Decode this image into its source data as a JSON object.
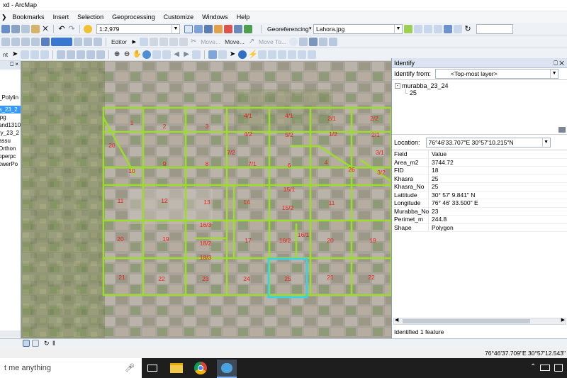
{
  "window": {
    "title": "xd - ArcMap"
  },
  "menu": [
    "Bookmarks",
    "Insert",
    "Selection",
    "Geoprocessing",
    "Customize",
    "Windows",
    "Help"
  ],
  "toolbar": {
    "scale_value": "1:2,979",
    "georef_label": "Georeferencing",
    "georef_layer": "Lahora.jpg",
    "editor_label": "Editor",
    "move_label": "Move...",
    "move2_label": "Move...",
    "move_to_label": "Move To...",
    "left_stub": "nt"
  },
  "toc": {
    "pin": "⎕ ×",
    "items": [
      {
        "label": "_Polylin",
        "selected": false
      },
      {
        "label": "a_23_2",
        "selected": true
      },
      {
        "label": "jpg",
        "selected": false
      },
      {
        "label": "and1310",
        "selected": false
      },
      {
        "label": "ry_23_2",
        "selected": false
      },
      {
        "label": "assu",
        "selected": false
      },
      {
        "label": "Orthon",
        "selected": false
      },
      {
        "label": "pperpc",
        "selected": false
      },
      {
        "label": "owerPo",
        "selected": false
      }
    ]
  },
  "map": {
    "parcels": [
      {
        "label": "1"
      },
      {
        "label": "2"
      },
      {
        "label": "3"
      },
      {
        "label": "4/1"
      },
      {
        "label": "4/1"
      },
      {
        "label": "2/1"
      },
      {
        "label": "2/2"
      },
      {
        "label": "20"
      },
      {
        "label": "4/2"
      },
      {
        "label": "5/2"
      },
      {
        "label": "1/2"
      },
      {
        "label": "2/1"
      },
      {
        "label": "10"
      },
      {
        "label": "9"
      },
      {
        "label": "8"
      },
      {
        "label": "7/2"
      },
      {
        "label": "7/1"
      },
      {
        "label": "6"
      },
      {
        "label": "4"
      },
      {
        "label": "26"
      },
      {
        "label": "3/1"
      },
      {
        "label": "3/2"
      },
      {
        "label": "15/1"
      },
      {
        "label": "11"
      },
      {
        "label": "12"
      },
      {
        "label": "13"
      },
      {
        "label": "14"
      },
      {
        "label": "15/2"
      },
      {
        "label": "11"
      },
      {
        "label": "16/1"
      },
      {
        "label": "16/3"
      },
      {
        "label": "20"
      },
      {
        "label": "19"
      },
      {
        "label": "18/2"
      },
      {
        "label": "17"
      },
      {
        "label": "16/2"
      },
      {
        "label": "20"
      },
      {
        "label": "19"
      },
      {
        "label": "18/3"
      },
      {
        "label": "21"
      },
      {
        "label": "22"
      },
      {
        "label": "23"
      },
      {
        "label": "24"
      },
      {
        "label": "25"
      },
      {
        "label": "21"
      },
      {
        "label": "22"
      }
    ]
  },
  "identify": {
    "title": "Identify",
    "from_label": "Identify from:",
    "from_value": "<Top-most layer>",
    "tree_layer": "murabba_23_24",
    "tree_child": "25",
    "location_label": "Location:",
    "location_value": "76°46'33.707\"E  30°57'10.215\"N",
    "col_field": "Field",
    "col_value": "Value",
    "rows": [
      {
        "field": "Area_m2",
        "value": "3744.72"
      },
      {
        "field": "FID",
        "value": "18"
      },
      {
        "field": "Khasra",
        "value": "25"
      },
      {
        "field": "Khasra_No",
        "value": "25"
      },
      {
        "field": "Lattitude",
        "value": "30° 57' 9.841\" N"
      },
      {
        "field": "Longitude",
        "value": "76° 46' 33.500\" E"
      },
      {
        "field": "Murabba_No",
        "value": "23"
      },
      {
        "field": "Perimet_m",
        "value": "244.8"
      },
      {
        "field": "Shape",
        "value": "Polygon"
      }
    ],
    "footer": "Identified 1 feature"
  },
  "status": {
    "coords": "76°46'37.709\"E  30°57'12.543\""
  },
  "taskbar": {
    "search_placeholder": "t me anything"
  },
  "colors": {
    "parcel_line": "#9bdc2c",
    "parcel_label": "#e8231e",
    "highlight": "#35d4e8"
  }
}
